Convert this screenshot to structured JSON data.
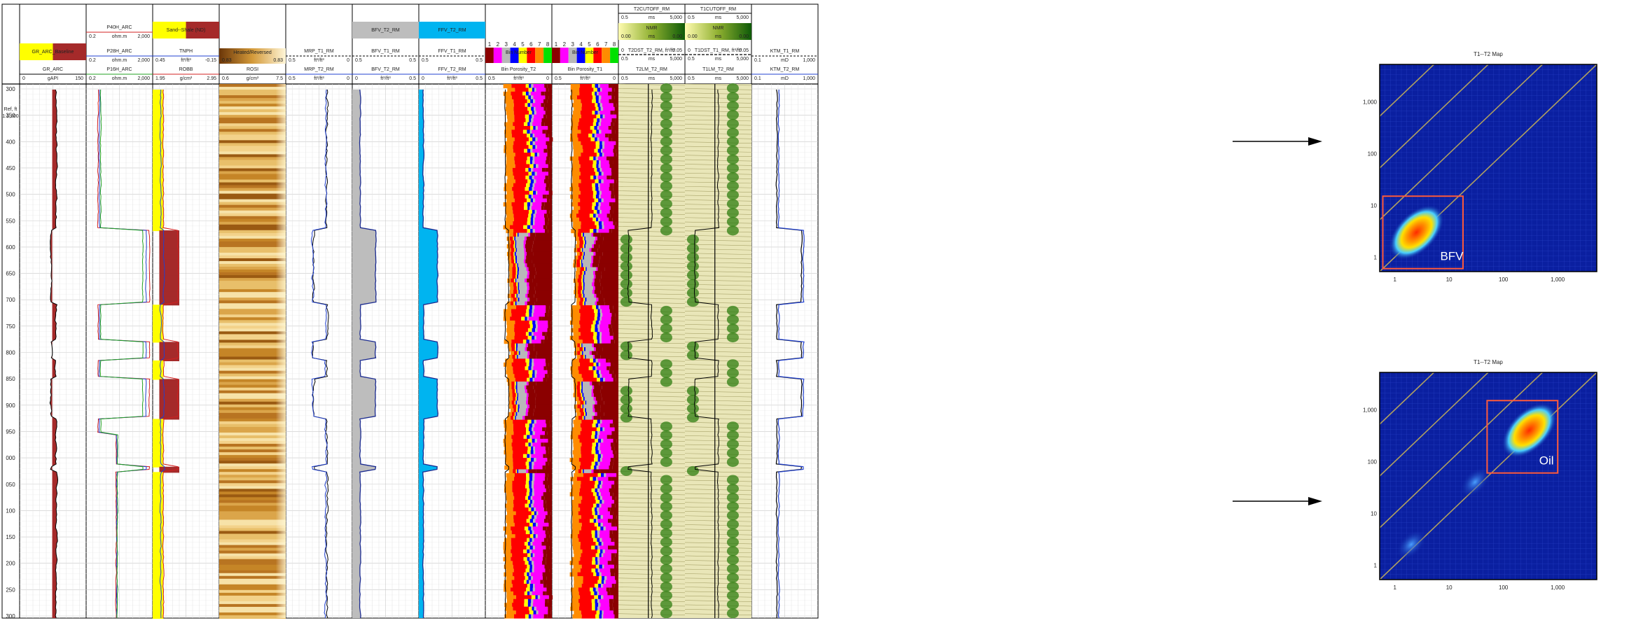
{
  "depth_track": {
    "ref": "Ref, ft",
    "scale": "1:1,200"
  },
  "depth_labels": [
    "300",
    "350",
    "400",
    "450",
    "500",
    "550",
    "600",
    "650",
    "700",
    "750",
    "800",
    "850",
    "900",
    "950",
    "000",
    "050",
    "100",
    "150",
    "200",
    "250",
    "300"
  ],
  "tracks": [
    {
      "id": "gr",
      "fill_label": "GR_ARC_Baseline",
      "curves": [
        {
          "name": "GR_ARC",
          "min": "0",
          "unit": "gAPI",
          "max": "150",
          "color": "#000000"
        }
      ]
    },
    {
      "id": "res",
      "curves": [
        {
          "name": "P40H_ARC",
          "min": "0.2",
          "unit": "ohm.m",
          "max": "2,000",
          "color": "#d32020"
        },
        {
          "name": "P28H_ARC",
          "min": "0.2",
          "unit": "ohm.m",
          "max": "2,000",
          "color": "#2040d0"
        },
        {
          "name": "P16H_ARC",
          "min": "0.2",
          "unit": "ohm.m",
          "max": "2,000",
          "color": "#20a020"
        }
      ]
    },
    {
      "id": "poro",
      "fill_label": "Sand--Shale (ND)",
      "curves": [
        {
          "name": "TNPH",
          "min": "0.45",
          "unit": "ft³/ft³",
          "max": "-0.15",
          "color": "#2040d0"
        },
        {
          "name": "ROBB",
          "min": "1.95",
          "unit": "g/cm³",
          "max": "2.95",
          "color": "#d32020"
        }
      ]
    },
    {
      "id": "rosi",
      "fill_label": "Heated/Reversed",
      "fill_min": "0.83",
      "fill_max": "0.83",
      "curves": [
        {
          "name": "ROSI",
          "min": "0.6",
          "unit": "g/cm³",
          "max": "7.5",
          "color": "#000000"
        }
      ]
    },
    {
      "id": "mrp",
      "curves": [
        {
          "name": "MRP_T1_RM",
          "min": "0.5",
          "unit": "ft³/ft³",
          "max": "0",
          "color": "#000000"
        },
        {
          "name": "MRP_T2_RM",
          "min": "0.5",
          "unit": "ft³/ft³",
          "max": "0",
          "color": "#2040d0"
        }
      ]
    },
    {
      "id": "bfv",
      "fill_label": "BFV_T2_RM",
      "curves": [
        {
          "name": "BFV_T1_RM",
          "min": "0.5",
          "unit": "",
          "max": "0.5",
          "color": "#000000"
        },
        {
          "name": "BFV_T2_RM",
          "min": "0",
          "unit": "ft³/ft³",
          "max": "0.5",
          "color": "#2040d0"
        }
      ]
    },
    {
      "id": "ffv",
      "fill_label": "FFV_T2_RM",
      "curves": [
        {
          "name": "FFV_T1_RM",
          "min": "0.5",
          "unit": "",
          "max": "0.5",
          "color": "#000000"
        },
        {
          "name": "FFV_T2_RM",
          "min": "0",
          "unit": "ft³/ft³",
          "max": "0.5",
          "color": "#2040d0"
        }
      ]
    },
    {
      "id": "bin2",
      "fill_label": "Bin Number",
      "curves": [
        {
          "name": "Bin Porosity_T2",
          "min": "0.5",
          "unit": "ft³/ft³",
          "max": "0",
          "color": "#000000"
        }
      ]
    },
    {
      "id": "bin1",
      "fill_label": "Bin Number",
      "curves": [
        {
          "name": "Bin Porosity_T1",
          "min": "0.5",
          "unit": "ft³/ft³",
          "max": "0",
          "color": "#000000"
        }
      ]
    },
    {
      "id": "t2",
      "cutoff": {
        "name": "T2CUTOFF_RM",
        "min": "0.5",
        "unit": "ms",
        "max": "5,000"
      },
      "fill_label": "NMR",
      "fill_min": "0.00",
      "fill_unit": "ms",
      "fill_max": "0.00",
      "curves": [
        {
          "name": "T2DST_T2_RM, ft³/ft³",
          "min": "0",
          "unit": "",
          "max": "0.05",
          "color": "#000000"
        },
        {
          "name": "",
          "min": "0.5",
          "unit": "ms",
          "max": "5,000",
          "color": "#000000"
        },
        {
          "name": "T2LM_T2_RM",
          "min": "0.5",
          "unit": "ms",
          "max": "5,000",
          "color": "#000000"
        }
      ]
    },
    {
      "id": "t1",
      "cutoff": {
        "name": "T1CUTOFF_RM",
        "min": "0.5",
        "unit": "ms",
        "max": "5,000"
      },
      "fill_label": "NMR",
      "fill_min": "0.00",
      "fill_unit": "ms",
      "fill_max": "0.00",
      "curves": [
        {
          "name": "T1DST_T1_RM, ft³/ft³",
          "min": "0",
          "unit": "",
          "max": "0.05",
          "color": "#000000"
        },
        {
          "name": "",
          "min": "0.5",
          "unit": "ms",
          "max": "5,000",
          "color": "#000000"
        },
        {
          "name": "T1LM_T2_RM",
          "min": "0.5",
          "unit": "ms",
          "max": "5,000",
          "color": "#000000"
        }
      ]
    },
    {
      "id": "ktm",
      "curves": [
        {
          "name": "KTM_T1_RM",
          "min": "0.1",
          "unit": "mD",
          "max": "1,000",
          "color": "#000000"
        },
        {
          "name": "KTM_T2_RM",
          "min": "0.1",
          "unit": "mD",
          "max": "1,000",
          "color": "#2040d0"
        }
      ]
    }
  ],
  "bin_numbers": [
    "1",
    "2",
    "3",
    "4",
    "5",
    "6",
    "7",
    "8"
  ],
  "bin_colors": [
    "#8b0000",
    "#ff00ff",
    "#b8b8b8",
    "#0000ff",
    "#ffff00",
    "#ff0000",
    "#ff8c00",
    "#00e000"
  ],
  "colors": {
    "gr_fill": "#a52a2a",
    "sand": "#ffff00",
    "bfv": "#bdbdbd",
    "ffv": "#00b4f0",
    "nmr": "#2e7d10"
  },
  "chart_data": [
    {
      "type": "heatmap",
      "title": "T1--T2 Map",
      "x_ticks": [
        "1",
        "10",
        "100",
        "1,000"
      ],
      "y_ticks": [
        "1",
        "10",
        "100",
        "1,000"
      ],
      "annotation": "BFV",
      "peaks": [
        {
          "t2": 2.5,
          "t1": 3
        }
      ],
      "box": {
        "x": [
          0.6,
          18
        ],
        "y": [
          0.6,
          15
        ]
      }
    },
    {
      "type": "heatmap",
      "title": "T1--T2 Map",
      "x_ticks": [
        "1",
        "10",
        "100",
        "1,000"
      ],
      "y_ticks": [
        "1",
        "10",
        "100",
        "1,000"
      ],
      "annotation": "Oil",
      "peaks": [
        {
          "t2": 300,
          "t1": 400
        },
        {
          "t2": 30,
          "t1": 40
        },
        {
          "t2": 2,
          "t1": 2.5
        }
      ],
      "box": {
        "x": [
          50,
          1000
        ],
        "y": [
          60,
          1500
        ]
      }
    }
  ]
}
